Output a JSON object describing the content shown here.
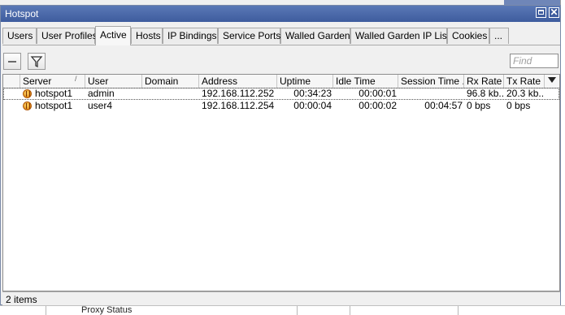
{
  "window": {
    "title": "Hotspot"
  },
  "tabs": [
    {
      "label": "Users"
    },
    {
      "label": "User Profiles"
    },
    {
      "label": "Active"
    },
    {
      "label": "Hosts"
    },
    {
      "label": "IP Bindings"
    },
    {
      "label": "Service Ports"
    },
    {
      "label": "Walled Garden"
    },
    {
      "label": "Walled Garden IP List"
    },
    {
      "label": "Cookies"
    },
    {
      "label": "..."
    }
  ],
  "active_tab": "Active",
  "toolbar": {
    "find_placeholder": "Find"
  },
  "table": {
    "columns": [
      "Server",
      "User",
      "Domain",
      "Address",
      "Uptime",
      "Idle Time",
      "Session Time ...",
      "Rx Rate",
      "Tx Rate"
    ],
    "rows": [
      {
        "server": "hotspot1",
        "user": "admin",
        "domain": "",
        "address": "192.168.112.252",
        "uptime": "00:34:23",
        "idle_time": "00:00:01",
        "session_time": "",
        "rx_rate": "96.8 kb...",
        "tx_rate": "20.3 kb..."
      },
      {
        "server": "hotspot1",
        "user": "user4",
        "domain": "",
        "address": "192.168.112.254",
        "uptime": "00:00:04",
        "idle_time": "00:00:02",
        "session_time": "00:04:57",
        "rx_rate": "0 bps",
        "tx_rate": "0 bps"
      }
    ]
  },
  "status": {
    "items_text": "2 items"
  },
  "background": {
    "partial_text": "Proxy Status"
  }
}
